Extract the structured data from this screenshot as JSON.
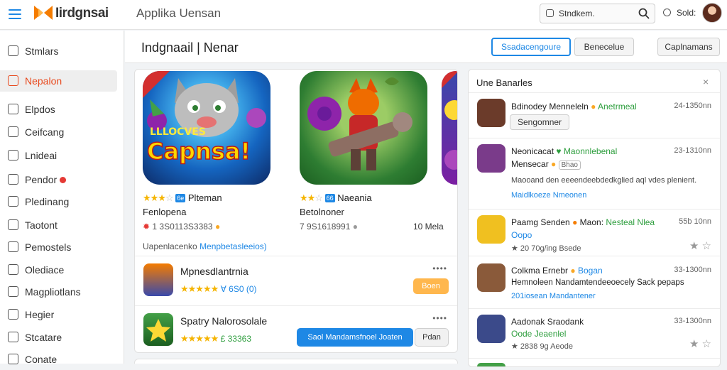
{
  "topbar": {
    "logo_text": "Iirdgnsai",
    "app_title": "Applika Uensan",
    "search_text": "Stndkem.",
    "status_label": "Sold:"
  },
  "sidebar": {
    "items": [
      {
        "label": "Stmlars",
        "icon": "home-icon"
      },
      {
        "label": "Nepalon",
        "icon": "grid-icon"
      },
      {
        "label": "Elpdos",
        "icon": "document-icon"
      },
      {
        "label": "Ceifcang",
        "icon": "settings-icon"
      },
      {
        "label": "Lnideai",
        "icon": "list-icon"
      },
      {
        "label": "Pendor",
        "icon": "pin-icon"
      },
      {
        "label": "Pledinang",
        "icon": "table-icon"
      },
      {
        "label": "Taotont",
        "icon": "send-icon"
      },
      {
        "label": "Pemostels",
        "icon": "box-icon"
      },
      {
        "label": "Olediace",
        "icon": "clock-icon"
      },
      {
        "label": "Magpliotlans",
        "icon": "chart-icon"
      },
      {
        "label": "Hegier",
        "icon": "calendar-icon"
      },
      {
        "label": "Stcatare",
        "icon": "pencil-icon"
      },
      {
        "label": "Conate",
        "icon": "lock-icon"
      }
    ],
    "active_index": 1
  },
  "header": {
    "title": "Indgnaail | Nenar",
    "btn_primary": "Ssadacengoure",
    "btn_mid": "Benecelue",
    "btn_right": "Caplnamans"
  },
  "featured": [
    {
      "tile_text": "Capnsa!",
      "tile_text_top": "LLLOCVES",
      "tag": "6e",
      "name": "Plteman",
      "sub": "Fenlopena",
      "stat": "1 3S0113S3383",
      "stars": "★★★",
      "grey": "☆"
    },
    {
      "tag": "66",
      "name": "Naeania",
      "sub": "Betolnoner",
      "stat": "7 9S1618991",
      "stars": "★★",
      "grey": "☆",
      "right": "10 Mela"
    }
  ],
  "featured_footer": {
    "left": "Uapenlacenko",
    "link": "Menpbetasleeios)"
  },
  "list": [
    {
      "name": "Mpnesdlantrnia",
      "stars": "★★★★★",
      "rating": "∀ 6S0 (0)",
      "button": "Boen",
      "menu": "••••"
    },
    {
      "name": "Spatry Nalorosolale",
      "stars": "★★★★★",
      "rating": "£ 33363",
      "button": "Saol Mandamsfnoel Joaten",
      "button2": "Pdan",
      "menu": "••••"
    }
  ],
  "right_panel": {
    "title": "Une Banarles",
    "close": "×",
    "items": [
      {
        "title": "Bdinodey Menneleln",
        "green": "Anetrmeal",
        "time": "24-1350nn",
        "chip": "Sengomner",
        "icon_color": "#6b3b2a"
      },
      {
        "title": "Neonicacat",
        "green": "Maonnlebenal",
        "time": "23-1310nn",
        "sub": "Mensecar",
        "sub_badge": "Bhao",
        "desc": "Maooand den eeeendeebdedkglied aql vdes plenient.",
        "link": "Maidlkoeze Nmeonen",
        "icon_color": "#7a3b8a"
      },
      {
        "title": "Paamg Senden",
        "title2": "Maon:",
        "green": "Nesteal Nlea",
        "time": "55b 10nn",
        "blue_sub": "Oopo",
        "foot": "★ 20 70g/ing Bsede",
        "icon_color": "#f0c020"
      },
      {
        "title": "Colkma Ernebr",
        "blue": "Bogan",
        "time": "33-1300nn",
        "sub": "Hemnoleen Nandamtendeeoecely Sack pepaps",
        "link": "201iosean Mandantener",
        "icon_color": "#8a5a3a"
      },
      {
        "title": "Aadonak Sraodank",
        "time": "33-1300nn",
        "green_sub": "Oode Jeaenlel",
        "foot": "★ 2838 9g Aeode",
        "icon_color": "#3b4a8a"
      }
    ]
  }
}
